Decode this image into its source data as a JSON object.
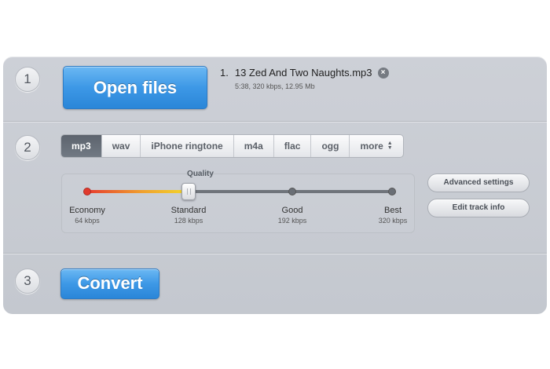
{
  "steps": [
    "1",
    "2",
    "3"
  ],
  "open_files": {
    "label": "Open files"
  },
  "file": {
    "index": "1.",
    "name": "13 Zed And Two Naughts.mp3",
    "meta": "5:38, 320 kbps, 12.95 Mb",
    "remove_icon": "close-circle-icon"
  },
  "formats": {
    "tabs": [
      "mp3",
      "wav",
      "iPhone ringtone",
      "m4a",
      "flac",
      "ogg",
      "more"
    ],
    "selected": "mp3",
    "more_icon": "updown-arrows-icon"
  },
  "quality": {
    "title": "Quality",
    "selected": "Standard",
    "stops": [
      {
        "name": "Economy",
        "rate": "64 kbps"
      },
      {
        "name": "Standard",
        "rate": "128 kbps"
      },
      {
        "name": "Good",
        "rate": "192 kbps"
      },
      {
        "name": "Best",
        "rate": "320 kbps"
      }
    ],
    "colors": {
      "low": "#e63a2e",
      "mid": "#f2d72a",
      "track": "#6f747b"
    }
  },
  "side_buttons": {
    "advanced": "Advanced settings",
    "track_info": "Edit track info"
  },
  "convert": {
    "label": "Convert"
  },
  "colors": {
    "accent": "#3d98e6",
    "panel": "#c9ccd3"
  }
}
